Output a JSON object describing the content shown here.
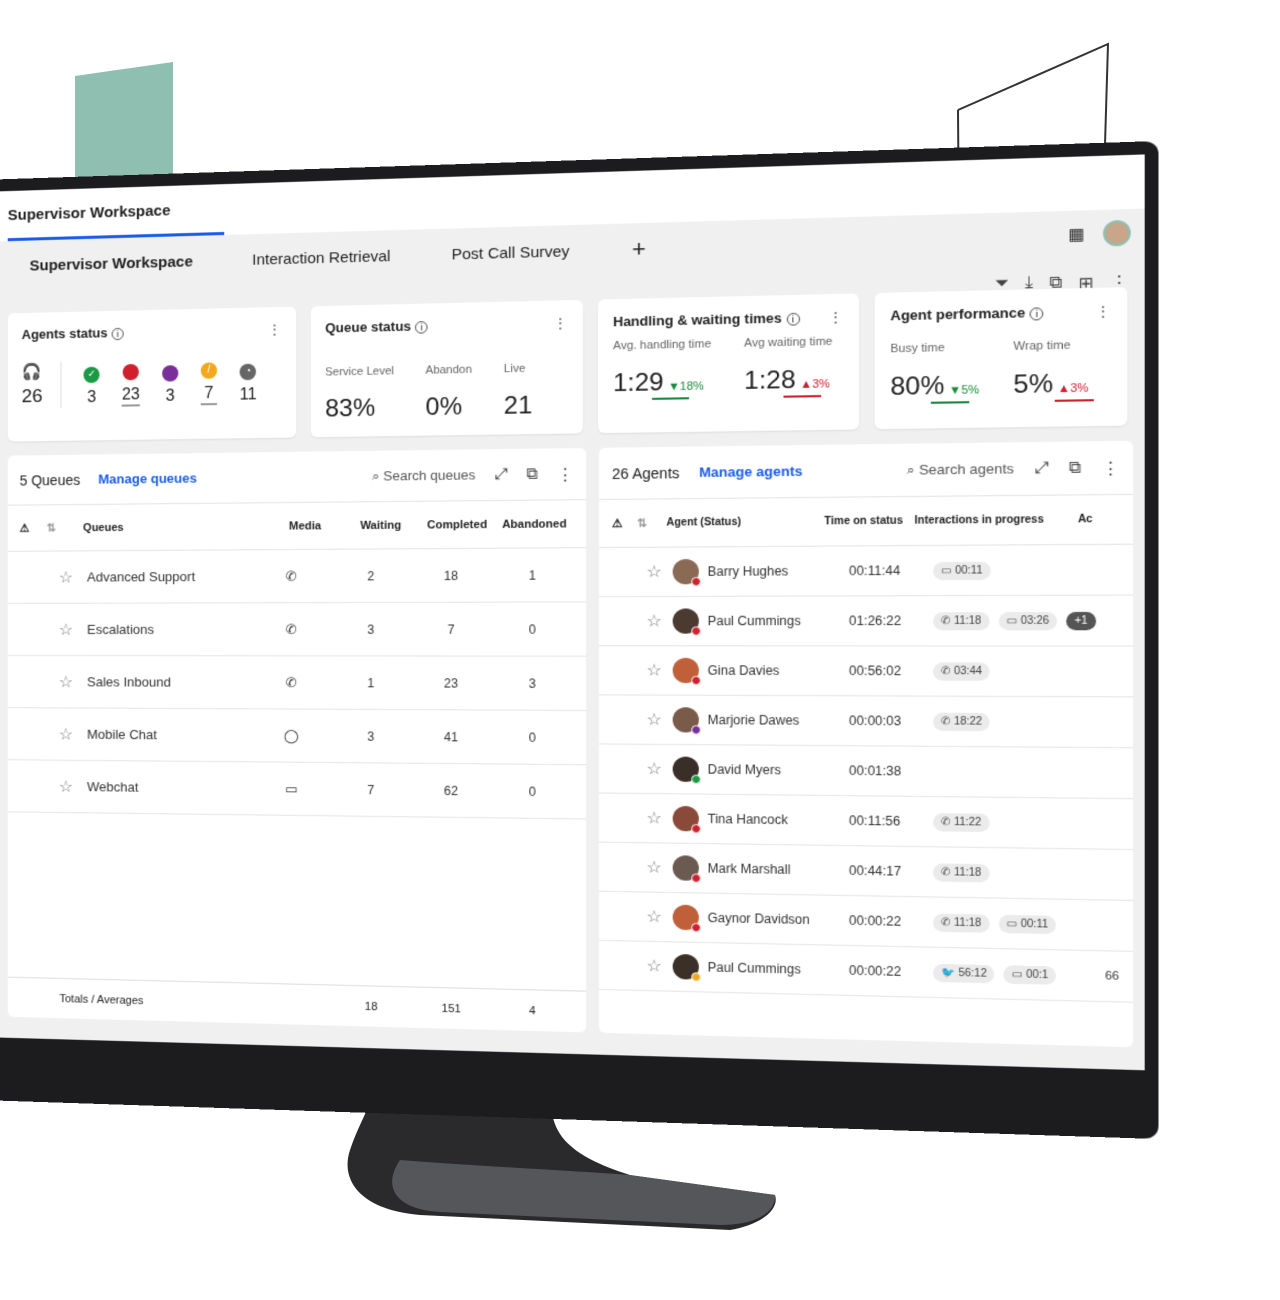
{
  "app": {
    "title": "Supervisor Workspace"
  },
  "tabs": [
    {
      "label": "Supervisor Workspace"
    },
    {
      "label": "Interaction Retrieval"
    },
    {
      "label": "Post Call Survey"
    }
  ],
  "tab_add": "+",
  "agents_status": {
    "title": "Agents status",
    "total": "26",
    "statuses": [
      {
        "value": "3",
        "color": "#1a9a44",
        "icon": "check"
      },
      {
        "value": "23",
        "color": "#d0202e",
        "icon": "busy"
      },
      {
        "value": "3",
        "color": "#7a2e9a",
        "icon": "circle"
      },
      {
        "value": "7",
        "color": "#f2a81d",
        "icon": "pencil"
      },
      {
        "value": "11",
        "color": "#666666",
        "icon": "clock"
      }
    ]
  },
  "queue_status": {
    "title": "Queue status",
    "metrics": [
      {
        "label": "Service Level",
        "value": "83%"
      },
      {
        "label": "Abandon",
        "value": "0%"
      },
      {
        "label": "Live",
        "value": "21"
      }
    ]
  },
  "handling": {
    "title": "Handling & waiting times",
    "metrics": [
      {
        "label": "Avg. handling time",
        "value": "1:29",
        "delta": "▼18%",
        "trend": "down"
      },
      {
        "label": "Avg waiting time",
        "value": "1:28",
        "delta": "▲3%",
        "trend": "up"
      }
    ]
  },
  "performance": {
    "title": "Agent performance",
    "metrics": [
      {
        "label": "Busy time",
        "value": "80%",
        "delta": "▼5%",
        "trend": "down"
      },
      {
        "label": "Wrap time",
        "value": "5%",
        "delta": "▲3%",
        "trend": "up"
      }
    ]
  },
  "queues": {
    "count": "5 Queues",
    "manage": "Manage queues",
    "search_placeholder": "Search queues",
    "columns": [
      "Queues",
      "Media",
      "Waiting",
      "Completed",
      "Abandoned"
    ],
    "rows": [
      {
        "name": "Advanced Support",
        "media": "phone",
        "waiting": "2",
        "completed": "18",
        "abandoned": "1"
      },
      {
        "name": "Escalations",
        "media": "phone",
        "waiting": "3",
        "completed": "7",
        "abandoned": "0"
      },
      {
        "name": "Sales Inbound",
        "media": "phone",
        "waiting": "1",
        "completed": "23",
        "abandoned": "3"
      },
      {
        "name": "Mobile Chat",
        "media": "whatsapp",
        "waiting": "3",
        "completed": "41",
        "abandoned": "0"
      },
      {
        "name": "Webchat",
        "media": "chat",
        "waiting": "7",
        "completed": "62",
        "abandoned": "0"
      }
    ],
    "totals": {
      "label": "Totals / Averages",
      "waiting": "18",
      "completed": "151",
      "abandoned": "4"
    }
  },
  "agents": {
    "count": "26 Agents",
    "manage": "Manage agents",
    "search_placeholder": "Search agents",
    "columns": [
      "Agent (Status)",
      "Time on status",
      "Interactions in progress",
      "Ac"
    ],
    "rows": [
      {
        "name": "Barry Hughes",
        "time": "00:11:44",
        "status_color": "#d0202e",
        "chips": [
          {
            "icon": "chat",
            "t": "00:11"
          }
        ]
      },
      {
        "name": "Paul Cummings",
        "time": "01:26:22",
        "status_color": "#d0202e",
        "chips": [
          {
            "icon": "phone",
            "t": "11:18"
          },
          {
            "icon": "chat",
            "t": "03:26"
          },
          {
            "icon": "plus",
            "t": "+1"
          }
        ]
      },
      {
        "name": "Gina Davies",
        "time": "00:56:02",
        "status_color": "#d0202e",
        "chips": [
          {
            "icon": "phone",
            "t": "03:44"
          }
        ]
      },
      {
        "name": "Marjorie Dawes",
        "time": "00:00:03",
        "status_color": "#7a2e9a",
        "chips": [
          {
            "icon": "phone",
            "t": "18:22"
          }
        ]
      },
      {
        "name": "David Myers",
        "time": "00:01:38",
        "status_color": "#1a9a44",
        "chips": []
      },
      {
        "name": "Tina Hancock",
        "time": "00:11:56",
        "status_color": "#d0202e",
        "chips": [
          {
            "icon": "phone",
            "t": "11:22"
          }
        ]
      },
      {
        "name": "Mark Marshall",
        "time": "00:44:17",
        "status_color": "#d0202e",
        "chips": [
          {
            "icon": "phone",
            "t": "11:18"
          }
        ]
      },
      {
        "name": "Gaynor Davidson",
        "time": "00:00:22",
        "status_color": "#d0202e",
        "chips": [
          {
            "icon": "phone",
            "t": "11:18"
          },
          {
            "icon": "chat",
            "t": "00:11"
          }
        ]
      },
      {
        "name": "Paul Cummings",
        "time": "00:00:22",
        "status_color": "#f2a81d",
        "chips": [
          {
            "icon": "twitter",
            "t": "56:12"
          },
          {
            "icon": "chat",
            "t": "00:1"
          }
        ],
        "extra": "66"
      }
    ]
  }
}
